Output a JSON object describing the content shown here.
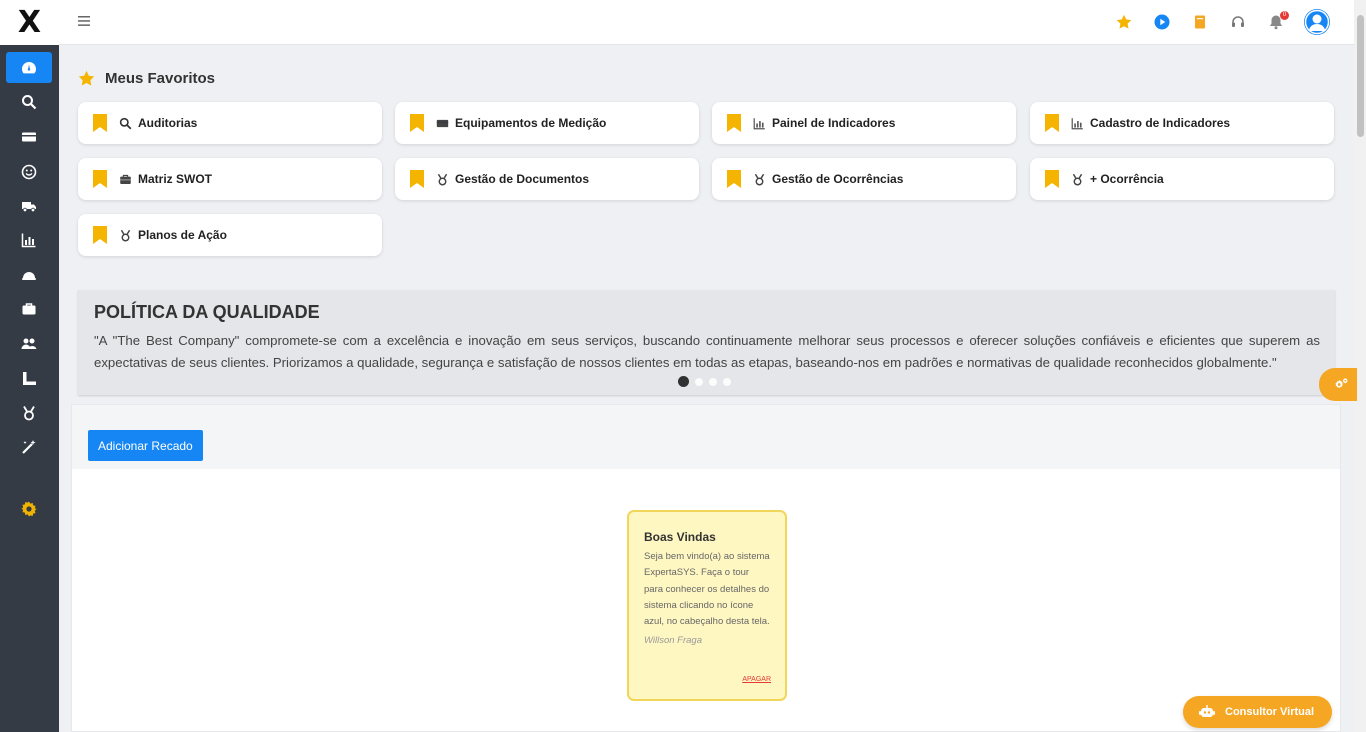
{
  "app": {
    "logo_text": "X"
  },
  "sidebar": {
    "items": [
      {
        "name": "sidebar-item-dashboard",
        "icon": "gauge-icon",
        "active": true
      },
      {
        "name": "sidebar-item-search",
        "icon": "search-icon"
      },
      {
        "name": "sidebar-item-equipments",
        "icon": "card-icon"
      },
      {
        "name": "sidebar-item-satisfaction",
        "icon": "smiley-icon"
      },
      {
        "name": "sidebar-item-logistics",
        "icon": "truck-icon"
      },
      {
        "name": "sidebar-item-indicators",
        "icon": "chart-icon"
      },
      {
        "name": "sidebar-item-safety",
        "icon": "helmet-icon"
      },
      {
        "name": "sidebar-item-briefcase",
        "icon": "briefcase-icon"
      },
      {
        "name": "sidebar-item-users",
        "icon": "users-icon"
      },
      {
        "name": "sidebar-item-tools",
        "icon": "ruler-icon"
      },
      {
        "name": "sidebar-item-quality",
        "icon": "medal-icon"
      },
      {
        "name": "sidebar-item-wand",
        "icon": "wand-icon"
      },
      {
        "name": "sidebar-item-settings",
        "icon": "gear-icon"
      }
    ]
  },
  "header": {
    "notification_count": "0"
  },
  "favorites": {
    "title": "Meus Favoritos",
    "items": [
      {
        "label": "Auditorias",
        "icon": "search-icon"
      },
      {
        "label": "Equipamentos de Medição",
        "icon": "card-icon"
      },
      {
        "label": "Painel de Indicadores",
        "icon": "chart-icon"
      },
      {
        "label": "Cadastro de Indicadores",
        "icon": "chart-icon"
      },
      {
        "label": "Matriz SWOT",
        "icon": "briefcase-icon"
      },
      {
        "label": "Gestão de Documentos",
        "icon": "medal-icon"
      },
      {
        "label": "Gestão de Ocorrências",
        "icon": "medal-icon"
      },
      {
        "label": "+ Ocorrência",
        "icon": "medal-icon"
      },
      {
        "label": "Planos de Ação",
        "icon": "medal-icon"
      }
    ]
  },
  "policy": {
    "title": "POLÍTICA DA QUALIDADE",
    "text": "\"A \"The Best Company\" compromete-se com a excelência e inovação em seus serviços, buscando continuamente melhorar seus processos e oferecer soluções confiáveis e eficientes que superem as expectativas de seus clientes. Priorizamos a qualidade, segurança e satisfação de nossos clientes em todas as etapas, baseando-nos em padrões e normativas de qualidade reconhecidos globalmente.\"",
    "slide_count": 4,
    "active_slide": 1
  },
  "recados": {
    "add_button": "Adicionar Recado",
    "notes": [
      {
        "title": "Boas Vindas",
        "body": "Seja bem vindo(a) ao sistema ExpertaSYS. Faça o tour para conhecer os detalhes do sistema clicando no ícone azul, no cabeçalho desta tela.",
        "author": "Willson Fraga",
        "delete_label": "APAGAR"
      }
    ]
  },
  "consultor": {
    "label": "Consultor Virtual"
  },
  "colors": {
    "sidebar_bg": "#353b45",
    "accent_blue": "#1786f5",
    "accent_gold": "#f5b400",
    "accent_orange": "#f5a623",
    "note_bg": "#fff7c2"
  }
}
